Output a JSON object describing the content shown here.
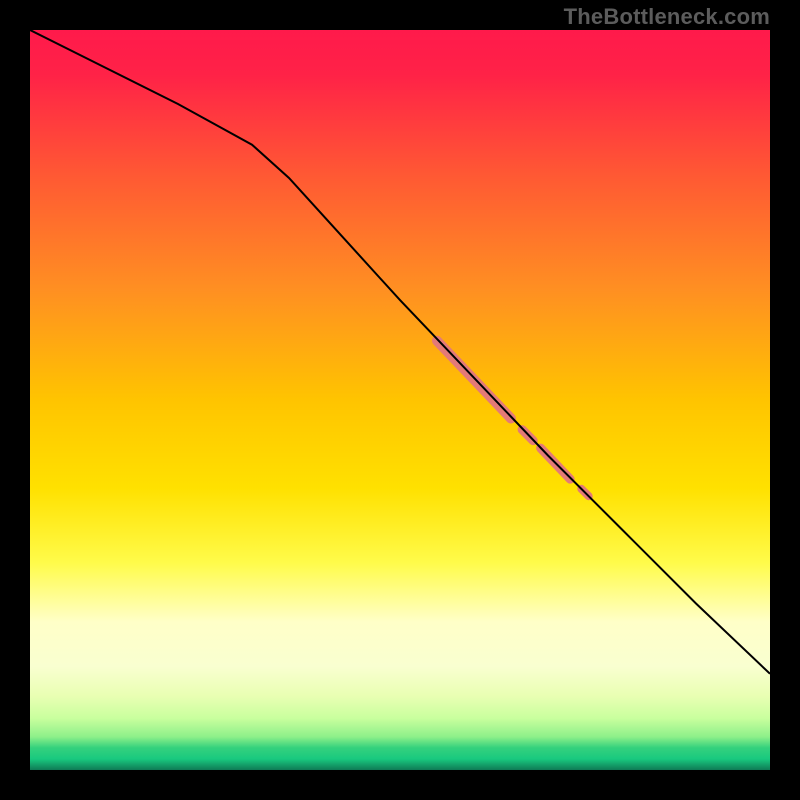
{
  "watermark": "TheBottleneck.com",
  "chart_data": {
    "type": "line",
    "title": "",
    "xlabel": "",
    "ylabel": "",
    "x_range": [
      0,
      100
    ],
    "y_range": [
      0,
      100
    ],
    "grid": false,
    "legend": false,
    "background_gradient_stops": [
      {
        "offset": 0.0,
        "color": "#ff1a4b"
      },
      {
        "offset": 0.06,
        "color": "#ff2247"
      },
      {
        "offset": 0.2,
        "color": "#ff5a33"
      },
      {
        "offset": 0.35,
        "color": "#ff8f22"
      },
      {
        "offset": 0.5,
        "color": "#ffc400"
      },
      {
        "offset": 0.62,
        "color": "#ffe100"
      },
      {
        "offset": 0.72,
        "color": "#fffb4a"
      },
      {
        "offset": 0.8,
        "color": "#ffffc8"
      },
      {
        "offset": 0.86,
        "color": "#f9ffd0"
      },
      {
        "offset": 0.9,
        "color": "#e9ffb3"
      },
      {
        "offset": 0.93,
        "color": "#c9ff9e"
      },
      {
        "offset": 0.955,
        "color": "#8ef08a"
      },
      {
        "offset": 0.97,
        "color": "#34d17d"
      },
      {
        "offset": 0.985,
        "color": "#19c97f"
      },
      {
        "offset": 1.0,
        "color": "#0f7a55"
      }
    ],
    "series": [
      {
        "name": "curve",
        "color": "#000000",
        "stroke_width": 2,
        "points": [
          {
            "x": 0,
            "y": 100.0
          },
          {
            "x": 10,
            "y": 95.0
          },
          {
            "x": 20,
            "y": 90.0
          },
          {
            "x": 30,
            "y": 84.5
          },
          {
            "x": 35,
            "y": 80.0
          },
          {
            "x": 40,
            "y": 74.5
          },
          {
            "x": 50,
            "y": 63.5
          },
          {
            "x": 60,
            "y": 53.0
          },
          {
            "x": 70,
            "y": 42.5
          },
          {
            "x": 80,
            "y": 32.5
          },
          {
            "x": 90,
            "y": 22.5
          },
          {
            "x": 100,
            "y": 13.0
          }
        ]
      }
    ],
    "highlight_segments": [
      {
        "x_start": 55,
        "y_start": 58.0,
        "x_end": 65,
        "y_end": 47.5,
        "width": 10,
        "color": "#e37a78"
      },
      {
        "x_start": 66.5,
        "y_start": 46.0,
        "x_end": 68.0,
        "y_end": 44.5,
        "width": 9,
        "color": "#e37a78"
      },
      {
        "x_start": 69.0,
        "y_start": 43.5,
        "x_end": 73.0,
        "y_end": 39.3,
        "width": 9,
        "color": "#e37a78"
      },
      {
        "x_start": 74.5,
        "y_start": 38.0,
        "x_end": 75.5,
        "y_end": 37.0,
        "width": 8,
        "color": "#e37a78"
      }
    ]
  }
}
